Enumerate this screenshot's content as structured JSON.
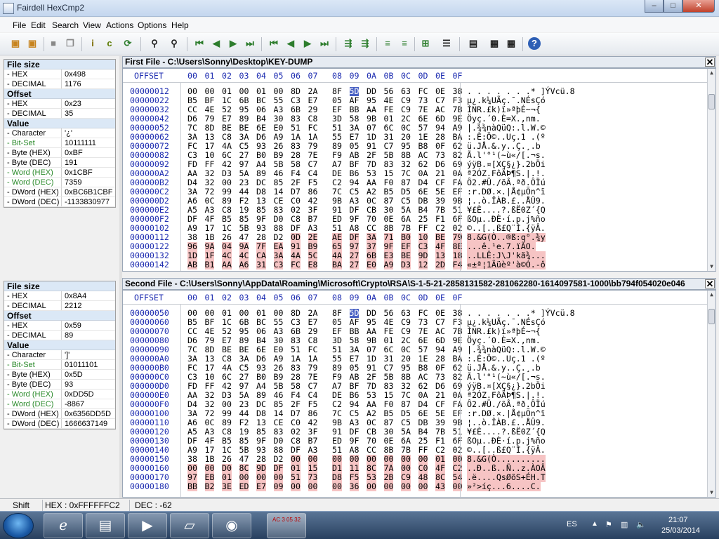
{
  "window": {
    "title": "Fairdell HexCmp2",
    "min": "–",
    "max": "□",
    "close": "✕"
  },
  "menu": [
    "File",
    "Edit",
    "Search",
    "View",
    "Actions",
    "Options",
    "Help"
  ],
  "colors": {
    "accent": "#1c2bb0",
    "diff": "#f6c4c4",
    "green": "#2a8a2a"
  },
  "icons": [
    "open-icon",
    "open2-icon",
    "stop-icon",
    "copy-icon",
    "info-icon",
    "compare-icon",
    "refresh-icon",
    "find-icon",
    "first-diff-icon",
    "prev-diff-icon",
    "next-diff-icon",
    "last-diff-icon",
    "first-icon",
    "prev-icon",
    "next-icon",
    "last-icon",
    "sync-icon",
    "sync2-icon",
    "align-icon",
    "align2-icon",
    "block-icon",
    "list-icon",
    "report-icon",
    "settings-icon",
    "settings2-icon",
    "help-icon"
  ],
  "info1": {
    "file_size_head": "File size",
    "hex_label": "- HEX",
    "hex": "0x498",
    "dec_label": "- DECIMAL",
    "dec": "1176",
    "offset_head": "Offset",
    "off_hex_label": "- HEX",
    "off_hex": "0x23",
    "off_dec_label": "- DECIMAL",
    "off_dec": "35",
    "value_head": "Value",
    "char_label": "- Character",
    "char": "'¿'",
    "bits_label": "- Bit-Set",
    "bits": "10111111",
    "bhex_label": "- Byte (HEX)",
    "bhex": "0xBF",
    "bdec_label": "- Byte (DEC)",
    "bdec": "191",
    "whex_label": "- Word (HEX)",
    "whex": "0x1CBF",
    "wdec_label": "- Word (DEC)",
    "wdec": "7359",
    "dhex_label": "- DWord (HEX)",
    "dhex": "0xBC6B1CBF",
    "ddec_label": "- DWord (DEC)",
    "ddec": "-1133830977"
  },
  "info2": {
    "file_size_head": "File size",
    "hex_label": "- HEX",
    "hex": "0x8A4",
    "dec_label": "- DECIMAL",
    "dec": "2212",
    "offset_head": "Offset",
    "off_hex_label": "- HEX",
    "off_hex": "0x59",
    "off_dec_label": "- DECIMAL",
    "off_dec": "89",
    "value_head": "Value",
    "char_label": "- Character",
    "char": "']'",
    "bits_label": "- Bit-Set",
    "bits": "01011101",
    "bhex_label": "- Byte (HEX)",
    "bhex": "0x5D",
    "bdec_label": "- Byte (DEC)",
    "bdec": "93",
    "whex_label": "- Word (HEX)",
    "whex": "0xDD5D",
    "wdec_label": "- Word (DEC)",
    "wdec": "-8867",
    "dhex_label": "- DWord (HEX)",
    "dhex": "0x6356DD5D",
    "ddec_label": "- DWord (DEC)",
    "ddec": "1666637149"
  },
  "pane1": {
    "title": "First File - C:\\Users\\Sonny\\Desktop\\KEY-DUMP",
    "offset_header": "OFFSET",
    "columns": [
      "00",
      "01",
      "02",
      "03",
      "04",
      "05",
      "06",
      "07",
      "08",
      "09",
      "0A",
      "0B",
      "0C",
      "0D",
      "0E",
      "0F"
    ],
    "rows": [
      {
        "off": "00000012",
        "bytes": [
          "00",
          "00",
          "01",
          "00",
          "01",
          "00",
          "8D",
          "2A",
          "8F",
          "5D",
          "DD",
          "56",
          "63",
          "FC",
          "0E",
          "38"
        ],
        "ascii": ". . . . . . .* ]ÝVcü.8"
      },
      {
        "off": "00000022",
        "bytes": [
          "B5",
          "BF",
          "1C",
          "6B",
          "BC",
          "55",
          "C3",
          "E7",
          "05",
          "AF",
          "95",
          "4E",
          "C9",
          "73",
          "C7",
          "F3"
        ],
        "ascii": "µ¿.k¼UÃç.¯.NÉsÇó"
      },
      {
        "off": "00000032",
        "bytes": [
          "CC",
          "4E",
          "52",
          "95",
          "06",
          "A3",
          "6B",
          "29",
          "EF",
          "BB",
          "AA",
          "FE",
          "C9",
          "7E",
          "AC",
          "7B"
        ],
        "ascii": "ÌNR.£k)ï»ªþÉ~¬{"
      },
      {
        "off": "00000042",
        "bytes": [
          "D6",
          "79",
          "E7",
          "89",
          "B4",
          "30",
          "83",
          "C8",
          "3D",
          "58",
          "9B",
          "01",
          "2C",
          "6E",
          "6D",
          "9E"
        ],
        "ascii": "Öyç.´0.È=X.,nm."
      },
      {
        "off": "00000052",
        "bytes": [
          "7C",
          "8D",
          "BE",
          "BE",
          "6E",
          "E0",
          "51",
          "FC",
          "51",
          "3A",
          "07",
          "6C",
          "0C",
          "57",
          "94",
          "A9"
        ],
        "ascii": "|.¾¾nàQüQ:.l.W.©"
      },
      {
        "off": "00000062",
        "bytes": [
          "3A",
          "13",
          "C8",
          "3A",
          "D6",
          "A9",
          "1A",
          "1A",
          "55",
          "E7",
          "1D",
          "31",
          "20",
          "1E",
          "28",
          "BA"
        ],
        "ascii": ":.È:Ö©..Uç.1 .(º"
      },
      {
        "off": "00000072",
        "bytes": [
          "FC",
          "17",
          "4A",
          "C5",
          "93",
          "26",
          "83",
          "79",
          "89",
          "05",
          "91",
          "C7",
          "95",
          "B8",
          "0F",
          "62"
        ],
        "ascii": "ü.JÅ.&.y..Ç.¸.b"
      },
      {
        "off": "00000082",
        "bytes": [
          "C3",
          "10",
          "6C",
          "27",
          "B0",
          "B9",
          "28",
          "7E",
          "F9",
          "AB",
          "2F",
          "5B",
          "8B",
          "AC",
          "73",
          "82"
        ],
        "ascii": "Ã.l'°¹(~ù«/[.¬s."
      },
      {
        "off": "00000092",
        "bytes": [
          "FD",
          "FF",
          "42",
          "97",
          "A4",
          "5B",
          "58",
          "C7",
          "A7",
          "BF",
          "7D",
          "83",
          "32",
          "62",
          "D6",
          "69"
        ],
        "ascii": "ýÿB.¤[XÇ§¿}.2bÖi"
      },
      {
        "off": "000000A2",
        "bytes": [
          "AA",
          "32",
          "D3",
          "5A",
          "89",
          "46",
          "F4",
          "C4",
          "DE",
          "B6",
          "53",
          "15",
          "7C",
          "0A",
          "21",
          "0A"
        ],
        "ascii": "ª2ÓZ.FôÄÞ¶S.|.!."
      },
      {
        "off": "000000B2",
        "bytes": [
          "D4",
          "32",
          "00",
          "23",
          "DC",
          "85",
          "2F",
          "F5",
          "C2",
          "94",
          "AA",
          "F0",
          "87",
          "D4",
          "CF",
          "FA"
        ],
        "ascii": "Ô2.#Ü./õÂ.ªð.ÔÏú"
      },
      {
        "off": "000000C2",
        "bytes": [
          "3A",
          "72",
          "99",
          "44",
          "D8",
          "14",
          "D7",
          "86",
          "7C",
          "C5",
          "A2",
          "B5",
          "D5",
          "6E",
          "5E",
          "EF"
        ],
        "ascii": ":r.DØ.×.|Å¢µÕn^ï"
      },
      {
        "off": "000000D2",
        "bytes": [
          "A6",
          "0C",
          "89",
          "F2",
          "13",
          "CE",
          "C0",
          "42",
          "9B",
          "A3",
          "0C",
          "87",
          "C5",
          "DB",
          "39",
          "9B"
        ],
        "ascii": "¦..ò.ÎÀB.£..ÅÛ9."
      },
      {
        "off": "000000E2",
        "bytes": [
          "A5",
          "A3",
          "C8",
          "19",
          "85",
          "83",
          "02",
          "3F",
          "91",
          "DF",
          "CB",
          "30",
          "5A",
          "B4",
          "7B",
          "51"
        ],
        "ascii": "¥£È....?.ßË0Z´{Q"
      },
      {
        "off": "000000F2",
        "bytes": [
          "DF",
          "4F",
          "B5",
          "85",
          "9F",
          "D0",
          "C8",
          "B7",
          "ED",
          "9F",
          "70",
          "0E",
          "6A",
          "25",
          "F1",
          "6F"
        ],
        "ascii": "ßOµ..ÐÈ·í.p.j%ño"
      },
      {
        "off": "00000102",
        "bytes": [
          "A9",
          "17",
          "1C",
          "5B",
          "93",
          "88",
          "DF",
          "A3",
          "51",
          "A8",
          "CC",
          "8B",
          "7B",
          "FF",
          "C2",
          "02"
        ],
        "ascii": "©..[..ß£Q¨Ì.{ÿÂ."
      },
      {
        "off": "00000112",
        "bytes": [
          "38",
          "1B",
          "26",
          "47",
          "28",
          "D2",
          "0D",
          "2E",
          "AE",
          "DF",
          "3A",
          "71",
          "B0",
          "10",
          "BE",
          "79"
        ],
        "ascii": "8.&G(Ò..®ß:q°.¾y"
      },
      {
        "off": "00000122",
        "bytes": [
          "96",
          "9A",
          "04",
          "9A",
          "7F",
          "EA",
          "91",
          "B9",
          "65",
          "97",
          "37",
          "9F",
          "EF",
          "C3",
          "4F",
          "8E"
        ],
        "ascii": "...ê.¹e.7.ïÃO."
      },
      {
        "off": "00000132",
        "bytes": [
          "1D",
          "1F",
          "4C",
          "4C",
          "CA",
          "3A",
          "4A",
          "5C",
          "4A",
          "27",
          "6B",
          "E3",
          "BE",
          "9D",
          "13",
          "18"
        ],
        "ascii": "..LLÊ:J\\J'kã¾..."
      },
      {
        "off": "00000142",
        "bytes": [
          "AB",
          "B1",
          "AA",
          "A6",
          "31",
          "C3",
          "FC",
          "E8",
          "BA",
          "27",
          "E0",
          "A9",
          "D3",
          "12",
          "2D",
          "F4"
        ],
        "ascii": "«±ª¦1Ãüèº'à©Ó.-ô"
      }
    ]
  },
  "pane2": {
    "title": "Second File - C:\\Users\\Sonny\\AppData\\Roaming\\Microsoft\\Crypto\\RSA\\S-1-5-21-2858131582-281062280-1614097581-1000\\bb794f054020e046",
    "offset_header": "OFFSET",
    "columns": [
      "00",
      "01",
      "02",
      "03",
      "04",
      "05",
      "06",
      "07",
      "08",
      "09",
      "0A",
      "0B",
      "0C",
      "0D",
      "0E",
      "0F"
    ],
    "rows": [
      {
        "off": "00000050",
        "bytes": [
          "00",
          "00",
          "01",
          "00",
          "01",
          "00",
          "8D",
          "2A",
          "8F",
          "5D",
          "DD",
          "56",
          "63",
          "FC",
          "0E",
          "38"
        ],
        "ascii": ". . . . . . .* ]ÝVcü.8"
      },
      {
        "off": "00000060",
        "bytes": [
          "B5",
          "BF",
          "1C",
          "6B",
          "BC",
          "55",
          "C3",
          "E7",
          "05",
          "AF",
          "95",
          "4E",
          "C9",
          "73",
          "C7",
          "F3"
        ],
        "ascii": "µ¿.k¼UÃç.¯.NÉsÇó"
      },
      {
        "off": "00000070",
        "bytes": [
          "CC",
          "4E",
          "52",
          "95",
          "06",
          "A3",
          "6B",
          "29",
          "EF",
          "BB",
          "AA",
          "FE",
          "C9",
          "7E",
          "AC",
          "7B"
        ],
        "ascii": "ÌNR.£k)ï»ªþÉ~¬{"
      },
      {
        "off": "00000080",
        "bytes": [
          "D6",
          "79",
          "E7",
          "89",
          "B4",
          "30",
          "83",
          "C8",
          "3D",
          "58",
          "9B",
          "01",
          "2C",
          "6E",
          "6D",
          "9E"
        ],
        "ascii": "Öyç.´0.È=X.,nm."
      },
      {
        "off": "00000090",
        "bytes": [
          "7C",
          "8D",
          "BE",
          "BE",
          "6E",
          "E0",
          "51",
          "FC",
          "51",
          "3A",
          "07",
          "6C",
          "0C",
          "57",
          "94",
          "A9"
        ],
        "ascii": "|.¾¾nàQüQ:.l.W.©"
      },
      {
        "off": "000000A0",
        "bytes": [
          "3A",
          "13",
          "C8",
          "3A",
          "D6",
          "A9",
          "1A",
          "1A",
          "55",
          "E7",
          "1D",
          "31",
          "20",
          "1E",
          "28",
          "BA"
        ],
        "ascii": ":.È:Ö©..Uç.1 .(º"
      },
      {
        "off": "000000B0",
        "bytes": [
          "FC",
          "17",
          "4A",
          "C5",
          "93",
          "26",
          "83",
          "79",
          "89",
          "05",
          "91",
          "C7",
          "95",
          "B8",
          "0F",
          "62"
        ],
        "ascii": "ü.JÅ.&.y..Ç.¸.b"
      },
      {
        "off": "000000C0",
        "bytes": [
          "C3",
          "10",
          "6C",
          "27",
          "B0",
          "B9",
          "28",
          "7E",
          "F9",
          "AB",
          "2F",
          "5B",
          "8B",
          "AC",
          "73",
          "82"
        ],
        "ascii": "Ã.l'°¹(~ù«/[.¬s."
      },
      {
        "off": "000000D0",
        "bytes": [
          "FD",
          "FF",
          "42",
          "97",
          "A4",
          "5B",
          "58",
          "C7",
          "A7",
          "BF",
          "7D",
          "83",
          "32",
          "62",
          "D6",
          "69"
        ],
        "ascii": "ýÿB.¤[XÇ§¿}.2bÖi"
      },
      {
        "off": "000000E0",
        "bytes": [
          "AA",
          "32",
          "D3",
          "5A",
          "89",
          "46",
          "F4",
          "C4",
          "DE",
          "B6",
          "53",
          "15",
          "7C",
          "0A",
          "21",
          "0A"
        ],
        "ascii": "ª2ÓZ.FôÄÞ¶S.|.!."
      },
      {
        "off": "000000F0",
        "bytes": [
          "D4",
          "32",
          "00",
          "23",
          "DC",
          "85",
          "2F",
          "F5",
          "C2",
          "94",
          "AA",
          "F0",
          "87",
          "D4",
          "CF",
          "FA"
        ],
        "ascii": "Ô2.#Ü./õÂ.ªð.ÔÏú"
      },
      {
        "off": "00000100",
        "bytes": [
          "3A",
          "72",
          "99",
          "44",
          "D8",
          "14",
          "D7",
          "86",
          "7C",
          "C5",
          "A2",
          "B5",
          "D5",
          "6E",
          "5E",
          "EF"
        ],
        "ascii": ":r.DØ.×.|Å¢µÕn^ï"
      },
      {
        "off": "00000110",
        "bytes": [
          "A6",
          "0C",
          "89",
          "F2",
          "13",
          "CE",
          "C0",
          "42",
          "9B",
          "A3",
          "0C",
          "87",
          "C5",
          "DB",
          "39",
          "9B"
        ],
        "ascii": "¦..ò.ÎÀB.£..ÅÛ9."
      },
      {
        "off": "00000120",
        "bytes": [
          "A5",
          "A3",
          "C8",
          "19",
          "85",
          "83",
          "02",
          "3F",
          "91",
          "DF",
          "CB",
          "30",
          "5A",
          "B4",
          "7B",
          "51"
        ],
        "ascii": "¥£È....?.ßË0Z´{Q"
      },
      {
        "off": "00000130",
        "bytes": [
          "DF",
          "4F",
          "B5",
          "85",
          "9F",
          "D0",
          "C8",
          "B7",
          "ED",
          "9F",
          "70",
          "0E",
          "6A",
          "25",
          "F1",
          "6F"
        ],
        "ascii": "ßOµ..ÐÈ·í.p.j%ño"
      },
      {
        "off": "00000140",
        "bytes": [
          "A9",
          "17",
          "1C",
          "5B",
          "93",
          "88",
          "DF",
          "A3",
          "51",
          "A8",
          "CC",
          "8B",
          "7B",
          "FF",
          "C2",
          "02"
        ],
        "ascii": "©..[..ß£Q¨Ì.{ÿÂ."
      },
      {
        "off": "00000150",
        "bytes": [
          "38",
          "1B",
          "26",
          "47",
          "28",
          "D2",
          "00",
          "00",
          "00",
          "00",
          "00",
          "00",
          "00",
          "00",
          "01",
          "00"
        ],
        "ascii": "8.&G(Ò.........."
      },
      {
        "off": "00000160",
        "bytes": [
          "00",
          "00",
          "D0",
          "8C",
          "9D",
          "DF",
          "01",
          "15",
          "D1",
          "11",
          "8C",
          "7A",
          "00",
          "C0",
          "4F",
          "C2"
        ],
        "ascii": "..Ð..ß..Ñ..z.ÀOÂ"
      },
      {
        "off": "00000170",
        "bytes": [
          "97",
          "EB",
          "01",
          "00",
          "00",
          "00",
          "51",
          "73",
          "D8",
          "F5",
          "53",
          "2B",
          "C9",
          "48",
          "8C",
          "54"
        ],
        "ascii": ".ë....QsØõS+ÉH.T"
      },
      {
        "off": "00000180",
        "bytes": [
          "BB",
          "B2",
          "3E",
          "ED",
          "E7",
          "09",
          "00",
          "00",
          "00",
          "36",
          "00",
          "00",
          "00",
          "00",
          "43",
          "00"
        ],
        "ascii": "»²>íç...6....C."
      }
    ]
  },
  "status": {
    "shift": "Shift",
    "hex": "HEX : 0xFFFFFFC2",
    "dec": "DEC : -62"
  },
  "taskbar": {
    "lang": "ES",
    "time": "21:07",
    "date": "25/03/2014",
    "calc_label": "AC 3 05 32"
  }
}
